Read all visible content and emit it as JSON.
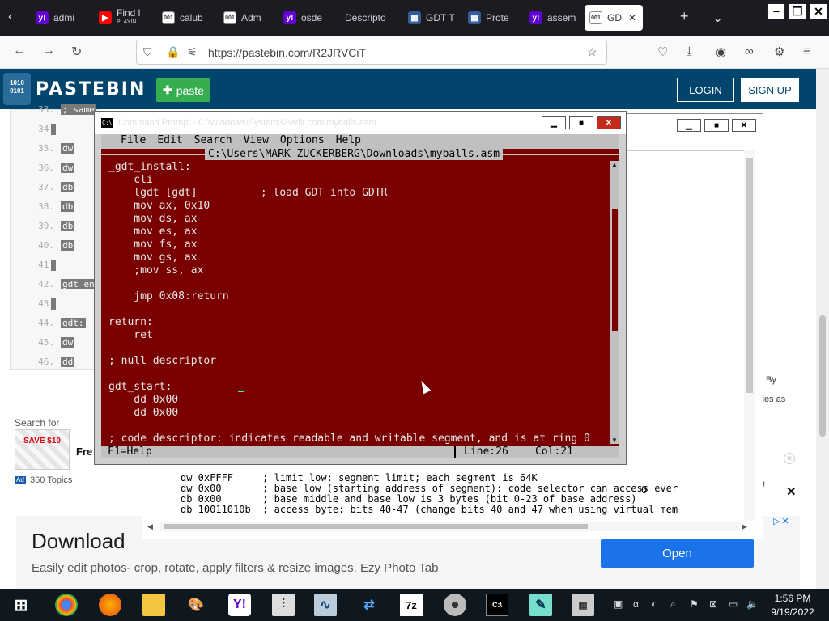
{
  "browser": {
    "tabs": [
      {
        "label": "admi",
        "icon": "yahoo"
      },
      {
        "label": "Find l",
        "sub": "PLAYIN",
        "icon": "youtube"
      },
      {
        "label": "calub",
        "icon": "doc"
      },
      {
        "label": "Adm",
        "icon": "doc"
      },
      {
        "label": "osde",
        "icon": "yahoo"
      },
      {
        "label": "Descripto",
        "icon": "blank"
      },
      {
        "label": "GDT T",
        "icon": "gdt"
      },
      {
        "label": "Prote",
        "icon": "gdt"
      },
      {
        "label": "assem",
        "icon": "yahoo"
      },
      {
        "label": "GD",
        "icon": "pastebin",
        "active": true
      }
    ],
    "url": "https://pastebin.com/R2JRVCiT",
    "window_controls": [
      "−",
      "❐",
      "✕"
    ],
    "tab_close": "✕",
    "new_tab": "+",
    "tab_list": "⌄"
  },
  "pastebin": {
    "logo_text": "PASTEBIN",
    "logo_badge": "1010 0101",
    "paste_label": "paste",
    "login_label": "LOGIN",
    "signup_label": "SIGN UP",
    "line_numbers": [
      "33.",
      "34.",
      "35.",
      "36.",
      "37.",
      "38.",
      "39.",
      "40.",
      "41.",
      "42.",
      "43.",
      "44.",
      "45.",
      "46."
    ],
    "code_tokens": [
      "; same",
      "",
      "dw",
      "dw",
      "db",
      "db",
      "db",
      "db",
      "",
      "gdt_end",
      "",
      "gdt:",
      "dw",
      "dd"
    ],
    "search_for": "Search for",
    "ad_thumb_text": "SAVE $10",
    "ad_title": "Fre",
    "ad_badge": "Ad",
    "ad_topics": "360 Topics",
    "download_title": "Download",
    "download_sub": "Easily edit photos- crop, rotate, apply filters & resize images. Ezy Photo Tab",
    "open_label": "Open",
    "cookie_by": "By",
    "cookie_as": "kies as",
    "right_close": "✕",
    "right_excl": "!"
  },
  "back_window": {
    "lines": [
      "dw 0xFFFF     ; limit low: segment limit; each segment is 64K",
      "dw 0x00       ; base low (starting address of segment): code selector can access ever",
      "db 0x00       ; base middle and base low is 3 bytes (bit 0-23 of base address)",
      "db 10011010b  ; access byte: bits 40-47 (change bits 40 and 47 when using virtual mem"
    ],
    "zero": "0"
  },
  "editor": {
    "caption": "Command Prompt - C:\\Windows\\System32\\edit.com myballs.asm",
    "menu": [
      "File",
      "Edit",
      "Search",
      "View",
      "Options",
      "Help"
    ],
    "filename": "C:\\Users\\MARK ZUCKERBERG\\Downloads\\myballs.asm",
    "code": [
      "_gdt_install:",
      "    cli",
      "    lgdt [gdt]          ; load GDT into GDTR",
      "    mov ax, 0x10",
      "    mov ds, ax",
      "    mov es, ax",
      "    mov fs, ax",
      "    mov gs, ax",
      "    ;mov ss, ax",
      "",
      "    jmp 0x08:return",
      "",
      "return:",
      "    ret",
      "",
      "; null descriptor",
      "",
      "gdt_start:",
      "    dd 0x00",
      "    dd 0x00",
      "",
      "; code descriptor: indicates readable and writable segment, and is at ring 0"
    ],
    "status_help": "F1=Help",
    "status_line": "Line:26",
    "status_col": "Col:21",
    "colors": {
      "background": "#7a0000",
      "text": "#e8e8e8",
      "chrome": "#c0c0c0"
    }
  },
  "taskbar": {
    "icons": [
      "windows-start",
      "chrome",
      "firefox",
      "file-explorer",
      "paint",
      "yahoo-messenger",
      "mixer",
      "perfmon",
      "network",
      "7zip",
      "dvd",
      "cmd",
      "notepad",
      "calculator"
    ],
    "time": "1:56 PM",
    "date": "9/19/2022"
  }
}
